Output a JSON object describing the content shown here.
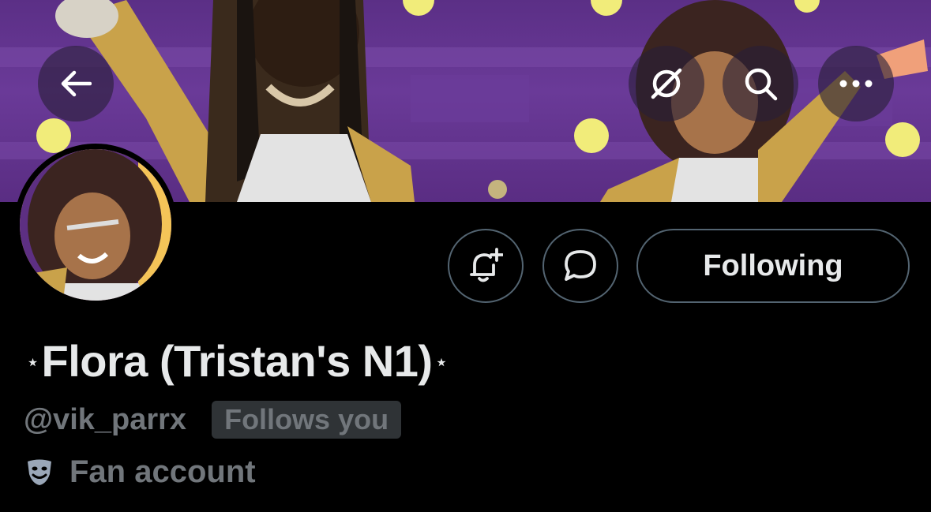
{
  "header": {
    "back_icon": "arrow-left-icon",
    "grok_icon": "grok-icon",
    "search_icon": "search-icon",
    "more_icon": "more-horizontal-icon"
  },
  "actions": {
    "notify_icon": "bell-plus-icon",
    "message_icon": "message-bubble-icon",
    "following_label": "Following"
  },
  "profile": {
    "display_name": "Flora (Tristan's N1)",
    "name_prefix": "⋆",
    "name_suffix": "⋆",
    "handle": "@vik_parrx",
    "follows_you": "Follows you",
    "category": "Fan account",
    "category_icon": "theater-masks-icon"
  },
  "colors": {
    "background": "#000000",
    "primary_text": "#e7e9ea",
    "secondary_text": "#71767b",
    "border": "#536471",
    "badge_bg": "#2f3336"
  }
}
